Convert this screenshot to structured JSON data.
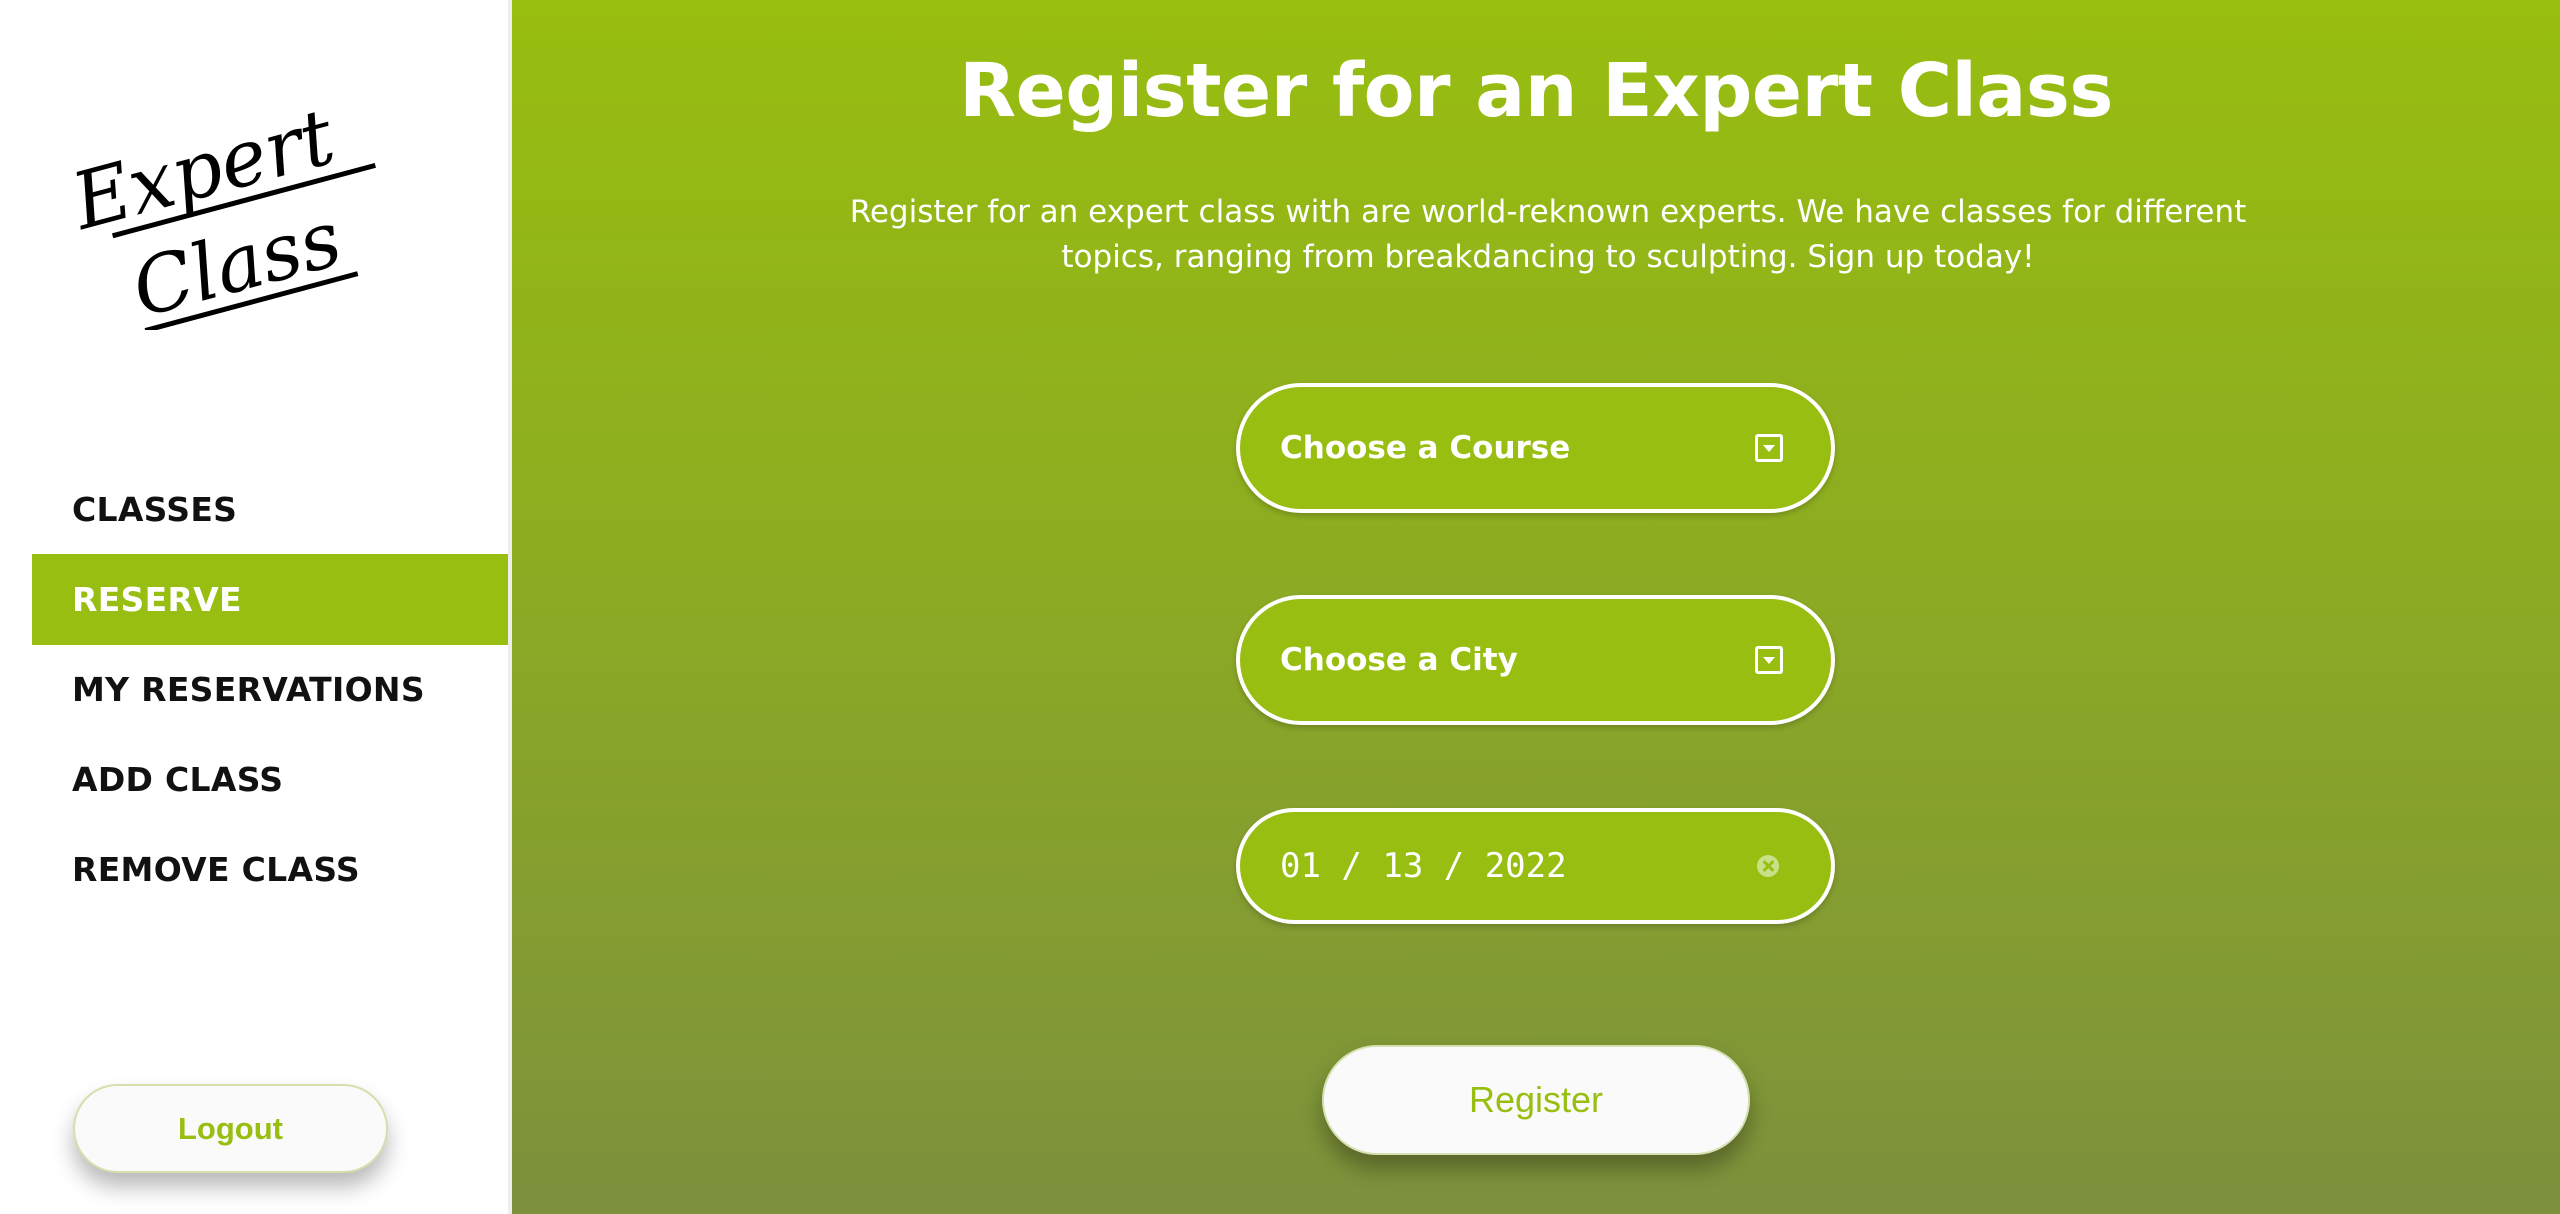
{
  "sidebar": {
    "logo": {
      "line1": "Expert",
      "line2": "Class"
    },
    "nav": [
      {
        "label": "CLASSES",
        "active": false
      },
      {
        "label": "RESERVE",
        "active": true
      },
      {
        "label": "MY RESERVATIONS",
        "active": false
      },
      {
        "label": "ADD CLASS",
        "active": false
      },
      {
        "label": "REMOVE CLASS",
        "active": false
      }
    ],
    "logout_label": "Logout"
  },
  "main": {
    "title": "Register for an Expert Class",
    "description": "Register for an expert class with are world-reknown experts. We have classes for different topics, ranging from breakdancing to sculpting. Sign up today!",
    "course_select": {
      "value": "Choose a Course",
      "icon": "dropdown-icon"
    },
    "city_select": {
      "value": "Choose a City",
      "icon": "dropdown-icon"
    },
    "date_input": {
      "value": "01 / 13 / 2022",
      "icon": "clear-icon"
    },
    "register_label": "Register"
  },
  "colors": {
    "accent": "#98BE11",
    "gradient_top": "#98BE0F",
    "gradient_bottom": "#7D903D",
    "text_dark": "#111111",
    "white": "#FFFFFF"
  }
}
